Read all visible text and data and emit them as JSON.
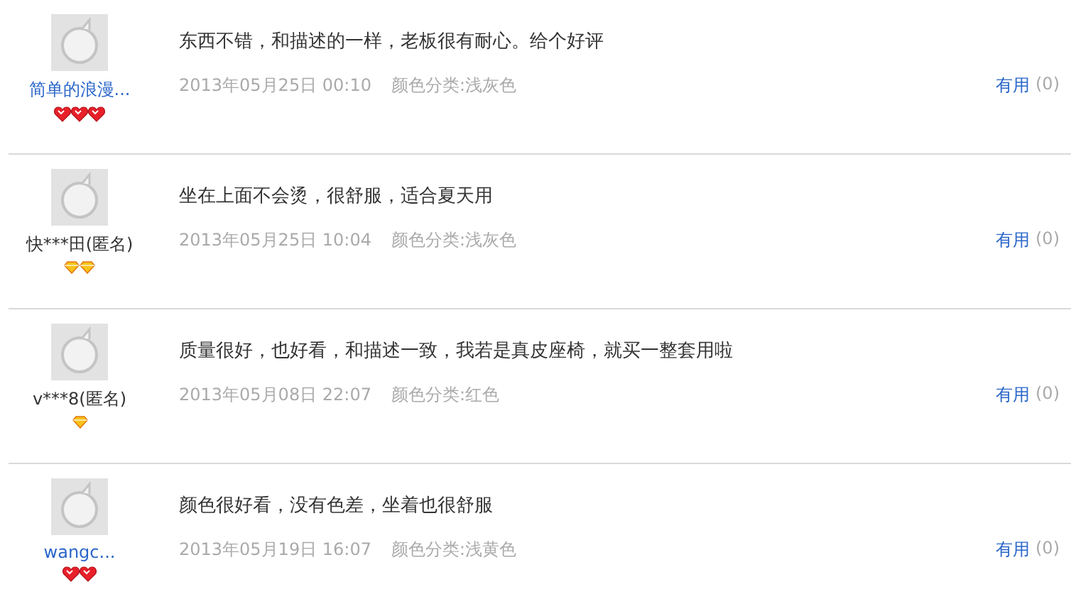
{
  "reviews": [
    {
      "user": {
        "name": "简单的浪漫...",
        "link": true,
        "rank_icons": [
          {
            "kind": "heart"
          },
          {
            "kind": "heart"
          },
          {
            "kind": "heart"
          }
        ]
      },
      "text": "东西不错，和描述的一样，老板很有耐心。给个好评",
      "date": "2013年05月25日 00:10",
      "variant": "颜色分类:浅灰色",
      "helpful": {
        "label": "有用",
        "count": "(0)"
      }
    },
    {
      "user": {
        "name": "快***田(匿名)",
        "link": false,
        "rank_icons": [
          {
            "kind": "diamond"
          },
          {
            "kind": "diamond"
          }
        ]
      },
      "text": "坐在上面不会烫，很舒服，适合夏天用",
      "date": "2013年05月25日 10:04",
      "variant": "颜色分类:浅灰色",
      "helpful": {
        "label": "有用",
        "count": "(0)"
      }
    },
    {
      "user": {
        "name": "v***8(匿名)",
        "link": false,
        "rank_icons": [
          {
            "kind": "diamond"
          }
        ]
      },
      "text": "质量很好，也好看，和描述一致，我若是真皮座椅，就买一整套用啦",
      "date": "2013年05月08日 22:07",
      "variant": "颜色分类:红色",
      "helpful": {
        "label": "有用",
        "count": "(0)"
      }
    },
    {
      "user": {
        "name": "wangc...",
        "link": true,
        "rank_icons": [
          {
            "kind": "heart"
          },
          {
            "kind": "heart"
          }
        ]
      },
      "text": "颜色很好看，没有色差，坐着也很舒服",
      "date": "2013年05月19日 16:07",
      "variant": "颜色分类:浅黄色",
      "helpful": {
        "label": "有用",
        "count": "(0)"
      }
    }
  ]
}
